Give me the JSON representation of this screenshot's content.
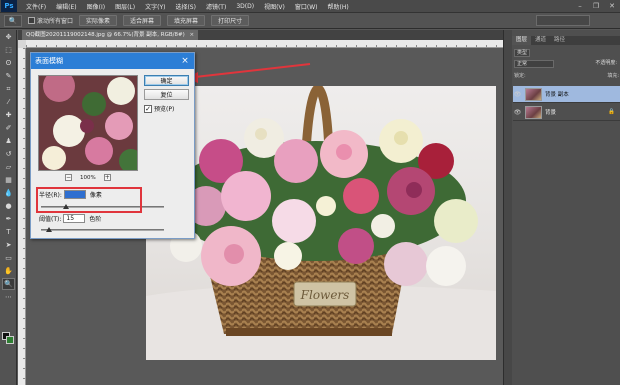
{
  "app": {
    "logo": "Ps"
  },
  "menubar": {
    "items": [
      "文件(F)",
      "编辑(E)",
      "图像(I)",
      "图层(L)",
      "文字(Y)",
      "选择(S)",
      "滤镜(T)",
      "3D(D)",
      "视图(V)",
      "窗口(W)",
      "帮助(H)"
    ]
  },
  "optionsbar": {
    "checkbox_label": "滚动所有窗口",
    "buttons": [
      "实际像素",
      "适合屏幕",
      "填充屏幕",
      "打印尺寸"
    ]
  },
  "document": {
    "tab_title": "QQ截图20201119002148.jpg @ 66.7%(背景 副本, RGB/8#)",
    "tab_close": "×"
  },
  "dialog": {
    "title": "表面模糊",
    "close": "×",
    "ok_label": "确定",
    "reset_label": "复位",
    "preview_label": "预览(P)",
    "preview_checked": "✓",
    "zoom_out": "−",
    "zoom_in": "+",
    "zoom_level": "100%",
    "radius_label": "半径(R):",
    "radius_value": "",
    "radius_unit": "像素",
    "threshold_label": "阈值(T):",
    "threshold_value": "15",
    "threshold_unit": "色阶"
  },
  "photo": {
    "basket_label": "Flowers"
  },
  "layers": {
    "tabs": [
      "图层",
      "通道",
      "路径"
    ],
    "filter_label": "类型",
    "blend_mode": "正常",
    "opacity_label": "不透明度:",
    "lock_label": "锁定:",
    "fill_label": "填充:",
    "items": [
      {
        "name": "背景 副本"
      },
      {
        "name": "背景"
      }
    ]
  },
  "colors": {
    "highlight": "#e0353c",
    "dialog_titlebar": "#2c7ed6",
    "selected_layer": "#9fb9df"
  }
}
